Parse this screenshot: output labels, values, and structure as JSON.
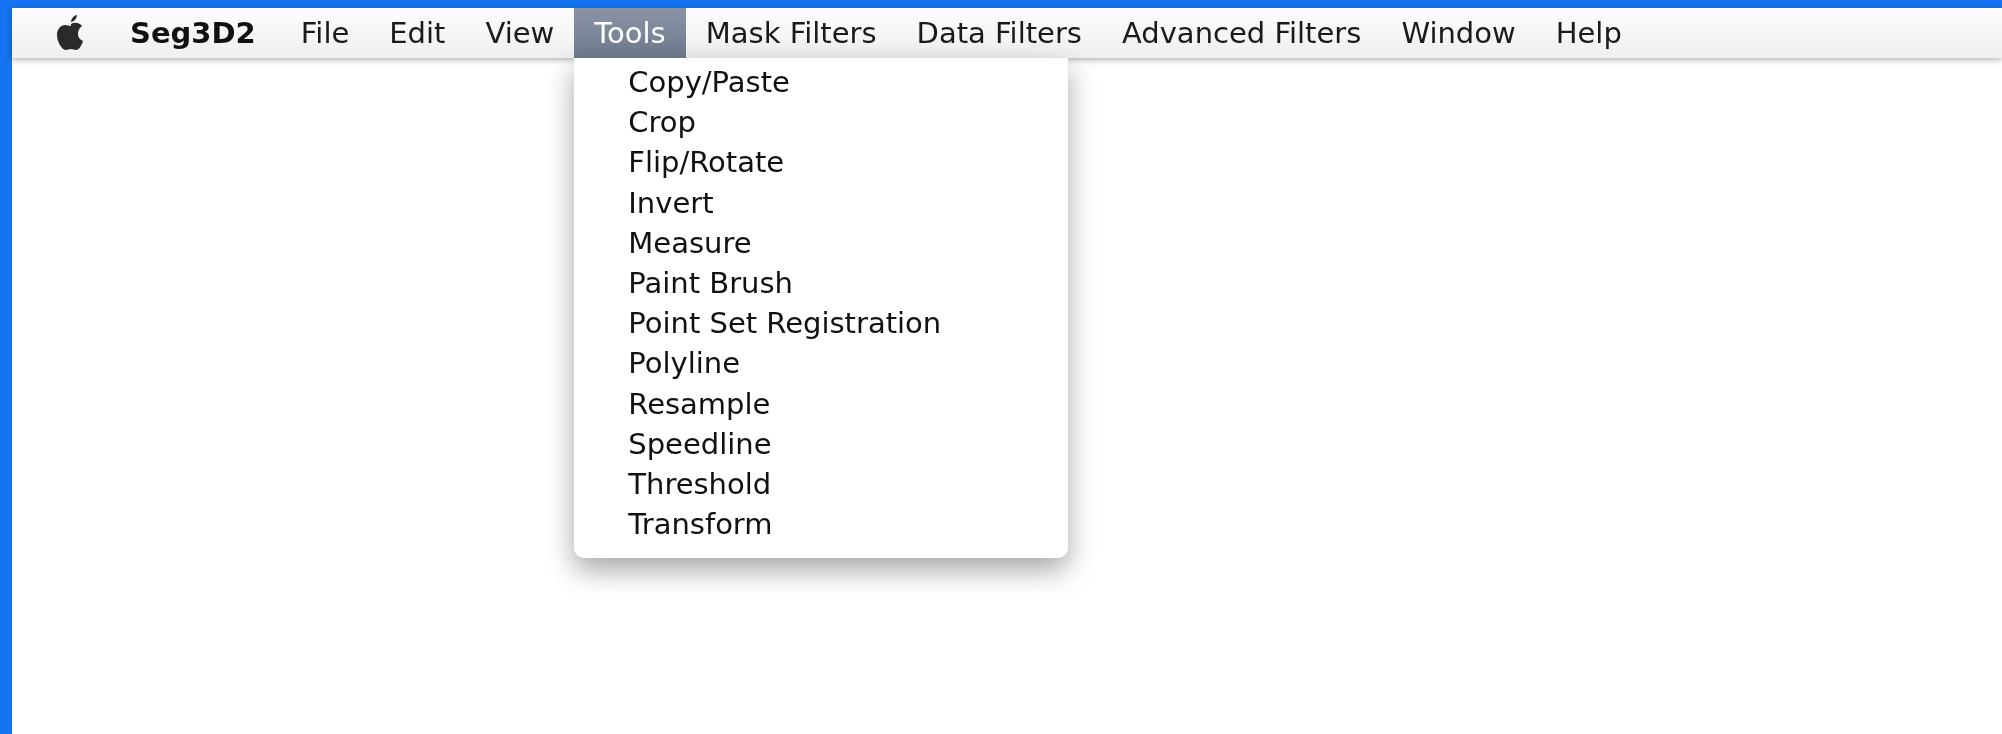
{
  "menu_bar": {
    "app_name": "Seg3D2",
    "menus": [
      {
        "label": "File",
        "selected": false
      },
      {
        "label": "Edit",
        "selected": false
      },
      {
        "label": "View",
        "selected": false
      },
      {
        "label": "Tools",
        "selected": true
      },
      {
        "label": "Mask Filters",
        "selected": false
      },
      {
        "label": "Data Filters",
        "selected": false
      },
      {
        "label": "Advanced Filters",
        "selected": false
      },
      {
        "label": "Window",
        "selected": false
      },
      {
        "label": "Help",
        "selected": false
      }
    ]
  },
  "open_menu": {
    "items": [
      "Copy/Paste",
      "Crop",
      "Flip/Rotate",
      "Invert",
      "Measure",
      "Paint Brush",
      "Point Set Registration",
      "Polyline",
      "Resample",
      "Speedline",
      "Threshold",
      "Transform"
    ]
  }
}
